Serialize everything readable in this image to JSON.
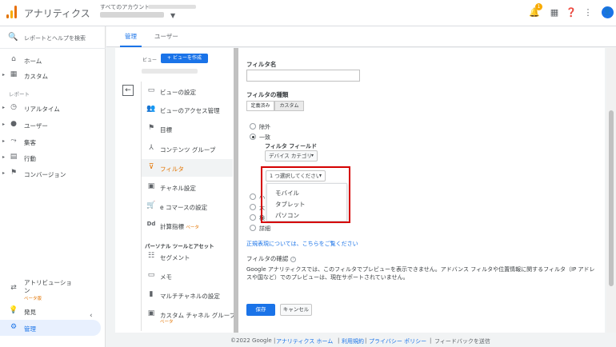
{
  "header": {
    "app_title": "アナリティクス",
    "account_label": "すべてのアカウント ›",
    "notification_count": "1",
    "avatar_letter": "👤"
  },
  "sidebar": {
    "search_placeholder": "レポートとヘルプを検索",
    "items": [
      {
        "label": "ホーム",
        "icon": "home-icon"
      },
      {
        "label": "カスタム",
        "icon": "grid-icon"
      },
      {
        "label": "リアルタイム",
        "icon": "clock-icon"
      },
      {
        "label": "ユーザー",
        "icon": "person-icon"
      },
      {
        "label": "集客",
        "icon": "acquisition-icon"
      },
      {
        "label": "行動",
        "icon": "behavior-icon"
      },
      {
        "label": "コンバージョン",
        "icon": "flag-icon"
      }
    ],
    "reports_label": "レポート",
    "attribution_label": "アトリビューション",
    "attribution_beta": "ベータ版",
    "discover_label": "発見",
    "admin_label": "管理"
  },
  "tabs": {
    "admin": "管理",
    "user": "ユーザー"
  },
  "view_column": {
    "view_label": "ビュー",
    "create_view": "+ ビューを作成",
    "items": [
      {
        "label": "ビューの設定"
      },
      {
        "label": "ビューのアクセス管理"
      },
      {
        "label": "目標"
      },
      {
        "label": "コンテンツ グループ"
      },
      {
        "label": "フィルタ"
      },
      {
        "label": "チャネル設定"
      },
      {
        "label": "e コマースの設定"
      },
      {
        "label": "計算指標"
      }
    ],
    "calc_beta": "ベータ",
    "personal_label": "パーソナル ツールとアセット",
    "personal_items": [
      {
        "label": "セグメント"
      },
      {
        "label": "メモ"
      },
      {
        "label": "マルチチャネルの設定"
      },
      {
        "label": "カスタム チャネル グループ"
      }
    ],
    "custom_channel_beta": "ベータ"
  },
  "form": {
    "filter_name_label": "フィルタ名",
    "filter_type_label": "フィルタの種類",
    "predefined_tab": "定義済み",
    "custom_tab": "カスタム",
    "exclude": "除外",
    "include": "一致",
    "filter_field_label": "フィルタ フィールド",
    "field_value": "デバイス カテゴリ",
    "select_prompt": "1 つ選択してください",
    "menu_options": [
      "モバイル",
      "タブレット",
      "パソコン"
    ],
    "partial_labels": [
      "小",
      "大",
      "検"
    ],
    "advanced": "詳細",
    "regex_link": "正規表現については、こちらをご覧ください",
    "verify_label": "フィルタの確認",
    "verify_desc": "Google アナリティクスでは、このフィルタでプレビューを表示できません。アドバンス フィルタや位置情報に関するフィルタ（IP アドレスや国など）でのプレビューは、現在サポートされていません。",
    "save": "保存",
    "cancel": "キャンセル"
  },
  "footer": {
    "copyright": "©2022 Google |",
    "home": "アナリティクス ホーム",
    "sep1": "|",
    "terms": "利用規約",
    "sep2": "|",
    "privacy": "プライバシー ポリシー",
    "sep3": "|",
    "feedback": "フィードバックを送信"
  },
  "colors": {
    "accent": "#1a73e8",
    "orange": "#e37400",
    "highlight": "#d50000"
  }
}
